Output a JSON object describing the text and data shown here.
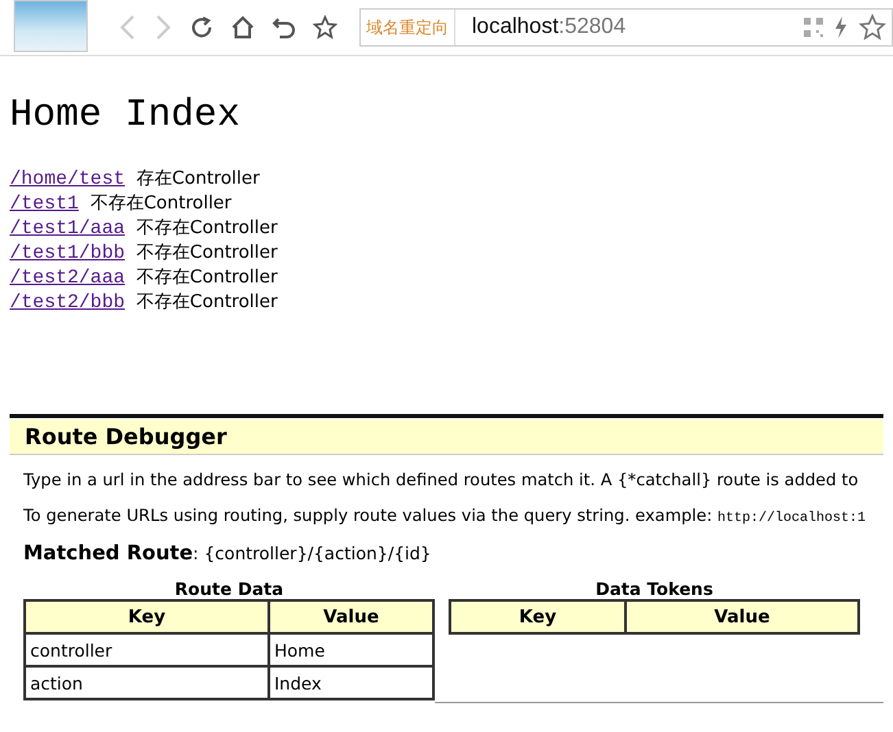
{
  "browser": {
    "redirect_badge": "域名重定向",
    "address": "localhost",
    "port": ":52804"
  },
  "heading": "Home Index",
  "links": [
    {
      "path": "/home/test",
      "note": "存在Controller"
    },
    {
      "path": "/test1",
      "note": "不存在Controller"
    },
    {
      "path": "/test1/aaa",
      "note": "不存在Controller"
    },
    {
      "path": "/test1/bbb",
      "note": "不存在Controller"
    },
    {
      "path": "/test2/aaa",
      "note": "不存在Controller"
    },
    {
      "path": "/test2/bbb",
      "note": "不存在Controller"
    }
  ],
  "debugger": {
    "title": "Route Debugger",
    "intro": "Type in a url in the address bar to see which defined routes match it. A {*catchall} route is added to",
    "hint": "To generate URLs using routing, supply route values via the query string. example: ",
    "example": "http://localhost:1",
    "matched_label": "Matched Route",
    "matched_value": ": {controller}/{action}/{id}",
    "route_data": {
      "caption": "Route Data",
      "columns": [
        "Key",
        "Value"
      ],
      "rows": [
        [
          "controller",
          "Home"
        ],
        [
          "action",
          "Index"
        ]
      ]
    },
    "data_tokens": {
      "caption": "Data Tokens",
      "columns": [
        "Key",
        "Value"
      ]
    }
  }
}
